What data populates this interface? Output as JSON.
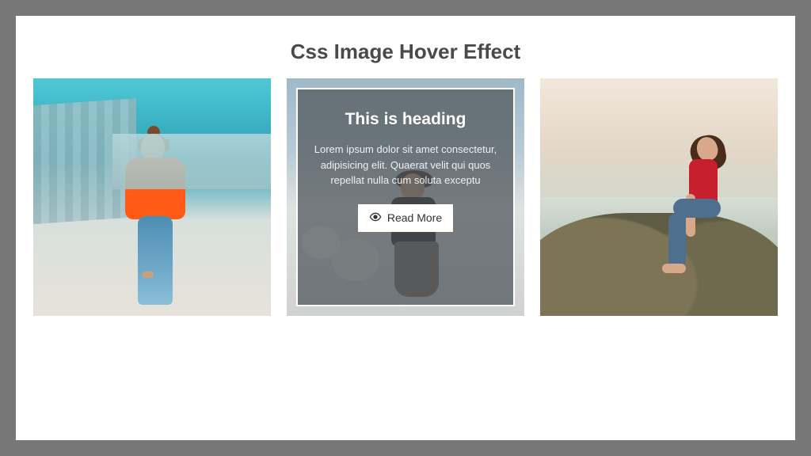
{
  "page": {
    "title": "Css Image Hover Effect"
  },
  "cards": [
    {
      "alt": "woman-in-orange-shirt-rooftop"
    },
    {
      "alt": "woman-in-black-top-seaside"
    },
    {
      "alt": "woman-in-red-top-on-rock"
    }
  ],
  "overlay": {
    "heading": "This is heading",
    "description": "Lorem ipsum dolor sit amet consectetur, adipisicing elit. Quaerat velit qui quos repellat nulla cum soluta exceptu",
    "button_label": "Read More"
  }
}
